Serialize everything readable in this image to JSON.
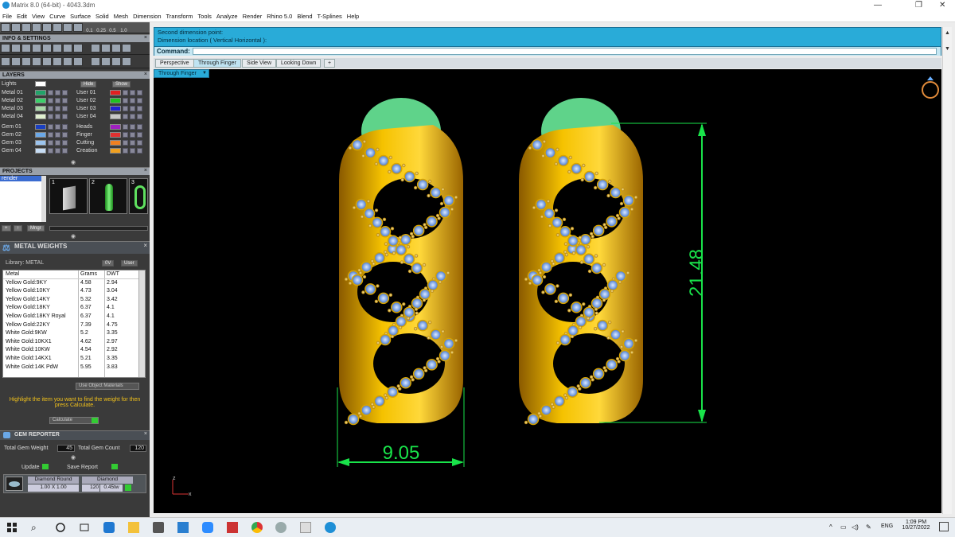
{
  "window": {
    "title": "Matrix 8.0 (64-bit) - 4043.3dm",
    "controls": [
      "—",
      "❐",
      "✕"
    ]
  },
  "menu": [
    "File",
    "Edit",
    "View",
    "Curve",
    "Surface",
    "Solid",
    "Mesh",
    "Dimension",
    "Transform",
    "Tools",
    "Analyze",
    "Render",
    "Rhino 5.0",
    "Blend",
    "T-Splines",
    "Help"
  ],
  "toolbar_mini": [
    "0.1",
    "0.25",
    "0.5",
    "1.0"
  ],
  "info_settings": {
    "title": "INFO & SETTINGS",
    "close": "×"
  },
  "layers": {
    "title": "LAYERS",
    "close": "×",
    "lights_label": "Lights",
    "hide_label": "Hide",
    "show_label": "Show",
    "left_groups": [
      [
        {
          "name": "Metal 01",
          "color": "#22a36a"
        },
        {
          "name": "Metal 02",
          "color": "#3bd06a"
        },
        {
          "name": "Metal 03",
          "color": "#a8d8a8"
        },
        {
          "name": "Metal 04",
          "color": "#e0f0d0"
        }
      ],
      [
        {
          "name": "Gem 01",
          "color": "#1a3fc0"
        },
        {
          "name": "Gem 02",
          "color": "#6aa8e8"
        },
        {
          "name": "Gem 03",
          "color": "#9cc4ee"
        },
        {
          "name": "Gem 04",
          "color": "#c6dcf4"
        }
      ]
    ],
    "right_groups": [
      [
        {
          "name": "User 01",
          "color": "#e02020"
        },
        {
          "name": "User 02",
          "color": "#20c020"
        },
        {
          "name": "User 03",
          "color": "#2020d0"
        },
        {
          "name": "User 04",
          "color": "#c8c8c8"
        }
      ],
      [
        {
          "name": "Heads",
          "color": "#a020c0"
        },
        {
          "name": "Finger",
          "color": "#e03030"
        },
        {
          "name": "Cutting",
          "color": "#f08020"
        },
        {
          "name": "Creation",
          "color": "#f0a020"
        }
      ]
    ]
  },
  "projects": {
    "title": "PROJECTS",
    "close": "×",
    "item": "render",
    "thumbs": [
      "1",
      "2",
      "3"
    ],
    "mngr": "Mngr"
  },
  "metal_weights": {
    "title": "METAL WEIGHTS",
    "close": "×",
    "library_label": "Library: METAL",
    "library_buttons": [
      "0V",
      "User"
    ],
    "columns": [
      "Metal",
      "Grams",
      "DWT"
    ],
    "rows": [
      [
        "Yellow Gold:9KY",
        "4.58",
        "2.94"
      ],
      [
        "Yellow Gold:10KY",
        "4.73",
        "3.04"
      ],
      [
        "Yellow Gold:14KY",
        "5.32",
        "3.42"
      ],
      [
        "Yellow Gold:18KY",
        "6.37",
        "4.1"
      ],
      [
        "Yellow Gold:18KY Royal",
        "6.37",
        "4.1"
      ],
      [
        "Yellow Gold:22KY",
        "7.39",
        "4.75"
      ],
      [
        "White Gold:9KW",
        "5.2",
        "3.35"
      ],
      [
        "White Gold:10KX1",
        "4.62",
        "2.97"
      ],
      [
        "White Gold:10KW",
        "4.54",
        "2.92"
      ],
      [
        "White Gold:14KX1",
        "5.21",
        "3.35"
      ],
      [
        "White Gold:14K PdW",
        "5.95",
        "3.83"
      ]
    ],
    "use_object_materials": "Use Object Materials",
    "hint": "Highlight the item you want to find the weight for then press Calculate.",
    "calculate": "Calculate"
  },
  "gem_reporter": {
    "title": "GEM REPORTER",
    "close": "×",
    "total_gem_weight_label": "Total Gem Weight",
    "total_gem_weight": "45",
    "total_gem_count_label": "Total Gem Count",
    "total_gem_count": "120",
    "update": "Update",
    "save_report": "Save Report",
    "gem_cut": "Diamond Round",
    "gem_type": "Diamond",
    "gem_size": "1.00 X 1.00",
    "gem_count": "120",
    "gem_weight": "0.45tw"
  },
  "command": {
    "line1": "Second dimension point:",
    "line2": "Dimension location ( Vertical  Horizontal ):",
    "label": "Command:",
    "value": ""
  },
  "view_tabs": [
    {
      "label": "Perspective",
      "active": false
    },
    {
      "label": "Through Finger",
      "active": true
    },
    {
      "label": "Side View",
      "active": false
    },
    {
      "label": "Looking Down",
      "active": false
    }
  ],
  "view_add": "+",
  "viewport_label": "Through Finger",
  "dimensions": {
    "height": "21.48",
    "width": "9.05"
  },
  "colors": {
    "accent": "#29abd8",
    "gold": "#e8b000",
    "dim": "#19e34a",
    "gem": "#8fb4e8",
    "green_base": "#5fd38a"
  },
  "axis": {
    "z": "z",
    "x": "x"
  },
  "taskbar": {
    "lang": "ENG",
    "time": "1:09 PM",
    "date": "10/27/2022"
  }
}
